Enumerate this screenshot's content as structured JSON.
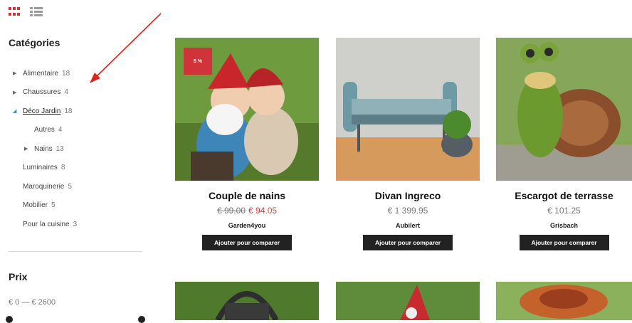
{
  "colors": {
    "accent": "#d0333a",
    "button": "#222222",
    "sale_price": "#d0453a",
    "active_arrow": "#2b8ec9"
  },
  "view_toggle": {
    "grid_icon": "grid-view-icon",
    "list_icon": "list-view-icon"
  },
  "sidebar": {
    "categories_heading": "Catégories",
    "categories": [
      {
        "label": "Alimentaire",
        "count": "18",
        "arrow": "▶"
      },
      {
        "label": "Chaussures",
        "count": "4",
        "arrow": "▶"
      },
      {
        "label": "Déco Jardin",
        "count": "18",
        "arrow": "◢"
      },
      {
        "label": "Autres",
        "count": "4"
      },
      {
        "label": "Nains",
        "count": "13",
        "arrow": "▶"
      },
      {
        "label": "Luminaires",
        "count": "8"
      },
      {
        "label": "Maroquinerie",
        "count": "5"
      },
      {
        "label": "Mobilier",
        "count": "5"
      },
      {
        "label": "Pour la cuisine",
        "count": "3"
      }
    ],
    "price_heading": "Prix",
    "price_range": "€ 0 — € 2600"
  },
  "products": [
    {
      "title": "Couple de nains",
      "old_price": "€ 99.00",
      "price": "€ 94.05",
      "brand": "Garden4you",
      "compare_label": "Ajouter pour comparer",
      "badge": "5 %"
    },
    {
      "title": "Divan Ingreco",
      "price": "€ 1 399.95",
      "brand": "Aubilert",
      "compare_label": "Ajouter pour comparer"
    },
    {
      "title": "Escargot de terrasse",
      "price": "€ 101.25",
      "brand": "Grisbach",
      "compare_label": "Ajouter pour comparer"
    }
  ]
}
